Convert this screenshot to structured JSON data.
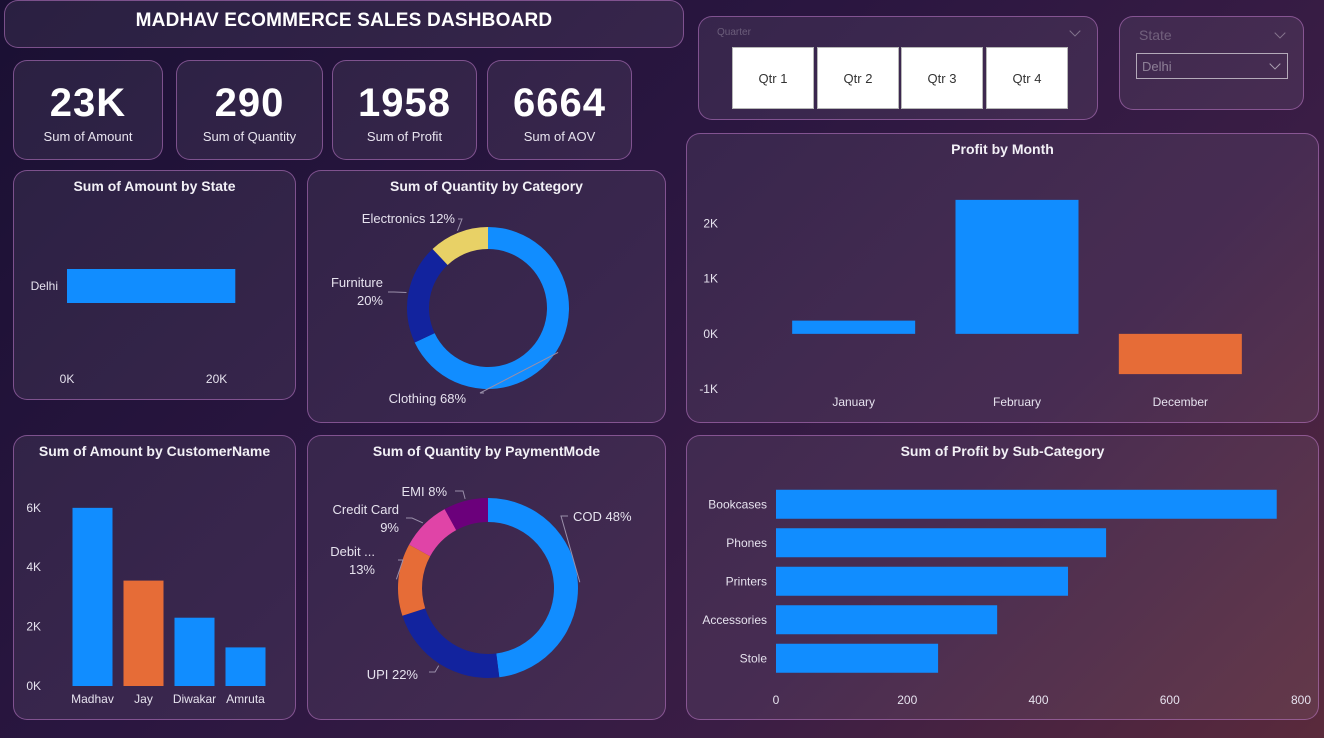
{
  "dashboard": {
    "title": "MADHAV ECOMMERCE SALES DASHBOARD"
  },
  "kpis": [
    {
      "value": "23K",
      "label": "Sum of Amount"
    },
    {
      "value": "290",
      "label": "Sum of Quantity"
    },
    {
      "value": "1958",
      "label": "Sum of Profit"
    },
    {
      "value": "6664",
      "label": "Sum of AOV"
    }
  ],
  "quarter_slicer": {
    "label": "Quarter",
    "options": [
      "Qtr 1",
      "Qtr 2",
      "Qtr 3",
      "Qtr 4"
    ]
  },
  "state_slicer": {
    "label": "State",
    "selected": "Delhi"
  },
  "colors": {
    "blue": "#118DFF",
    "orange": "#E66C37",
    "navy": "#12239E",
    "yellow": "#E8D166",
    "magenta": "#E044A7",
    "purple": "#6B007B"
  },
  "chart_data": [
    {
      "id": "amount_by_state",
      "type": "bar",
      "orientation": "horizontal",
      "title": "Sum of Amount by State",
      "categories": [
        "Delhi"
      ],
      "values": [
        22500
      ],
      "xlim": [
        0,
        25000
      ],
      "xticks": [
        {
          "value": 0,
          "label": "0K"
        },
        {
          "value": 20000,
          "label": "20K"
        }
      ],
      "grid": false
    },
    {
      "id": "quantity_by_category",
      "type": "pie",
      "donut": true,
      "title": "Sum of Quantity by Category",
      "slices": [
        {
          "name": "Clothing",
          "value": 68,
          "label": "Clothing 68%",
          "color": "#118DFF"
        },
        {
          "name": "Furniture",
          "value": 20,
          "label": "Furniture 20%",
          "color": "#12239E"
        },
        {
          "name": "Electronics",
          "value": 12,
          "label": "Electronics 12%",
          "color": "#E8D166"
        }
      ]
    },
    {
      "id": "profit_by_month",
      "type": "bar",
      "title": "Profit by Month",
      "categories": [
        "January",
        "February",
        "December"
      ],
      "values": [
        240,
        2430,
        -730
      ],
      "colors": [
        "#118DFF",
        "#118DFF",
        "#E66C37"
      ],
      "ylim": [
        -1000,
        2500
      ],
      "yticks": [
        {
          "value": 2000,
          "label": "2K"
        },
        {
          "value": 1000,
          "label": "1K"
        },
        {
          "value": 0,
          "label": "0K"
        },
        {
          "value": -1000,
          "label": "-1K"
        }
      ],
      "grid": false
    },
    {
      "id": "amount_by_customer",
      "type": "bar",
      "title": "Sum of Amount by CustomerName",
      "categories": [
        "Madhav",
        "Jay",
        "Diwakar",
        "Amruta"
      ],
      "values": [
        6000,
        3550,
        2300,
        1300
      ],
      "colors": [
        "#118DFF",
        "#E66C37",
        "#118DFF",
        "#118DFF"
      ],
      "ylim": [
        0,
        6500
      ],
      "yticks": [
        {
          "value": 0,
          "label": "0K"
        },
        {
          "value": 2000,
          "label": "2K"
        },
        {
          "value": 4000,
          "label": "4K"
        },
        {
          "value": 6000,
          "label": "6K"
        }
      ],
      "grid": false
    },
    {
      "id": "quantity_by_payment",
      "type": "pie",
      "donut": true,
      "title": "Sum of Quantity by PaymentMode",
      "slices": [
        {
          "name": "COD",
          "value": 48,
          "label": "COD 48%",
          "color": "#118DFF"
        },
        {
          "name": "UPI",
          "value": 22,
          "label": "UPI 22%",
          "color": "#12239E"
        },
        {
          "name": "Debit Card",
          "value": 13,
          "label": "Debit ... 13%",
          "color": "#E66C37"
        },
        {
          "name": "Credit Card",
          "value": 9,
          "label": "Credit Card 9%",
          "color": "#E044A7"
        },
        {
          "name": "EMI",
          "value": 8,
          "label": "EMI 8%",
          "color": "#6B007B"
        }
      ]
    },
    {
      "id": "profit_by_subcategory",
      "type": "bar",
      "orientation": "horizontal",
      "title": "Sum of Profit by Sub-Category",
      "categories": [
        "Bookcases",
        "Phones",
        "Printers",
        "Accessories",
        "Stole"
      ],
      "values": [
        763,
        503,
        445,
        337,
        247
      ],
      "xlim": [
        0,
        800
      ],
      "xticks": [
        {
          "value": 0,
          "label": "0"
        },
        {
          "value": 200,
          "label": "200"
        },
        {
          "value": 400,
          "label": "400"
        },
        {
          "value": 600,
          "label": "600"
        },
        {
          "value": 800,
          "label": "800"
        }
      ],
      "grid": false
    }
  ]
}
